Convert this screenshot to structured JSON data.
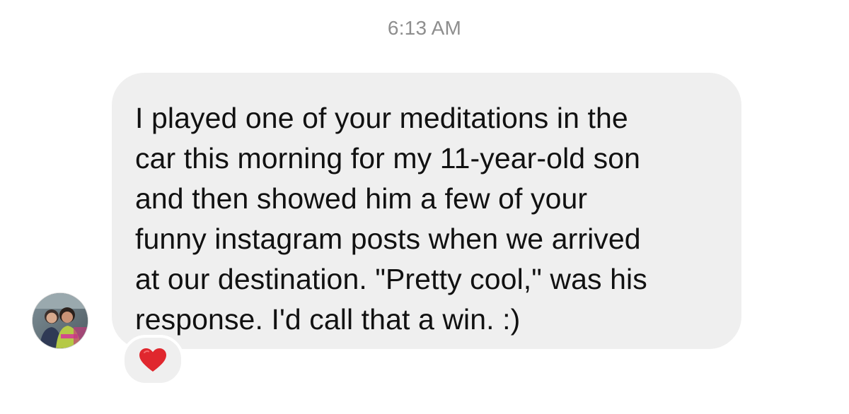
{
  "thread": {
    "timestamp": "6:13 AM"
  },
  "message": {
    "text": "I played one of your meditations in the\ncar this morning for my 11-year-old son\nand then showed him a few of your\nfunny instagram posts when we arrived\nat our destination. \"Pretty cool,\" was his\nresponse. I'd call that a win. :)",
    "bubble_color": "#efefef",
    "text_color": "#111111"
  },
  "reaction": {
    "icon": "red-heart-icon",
    "color": "#e0272e"
  },
  "sender": {
    "avatar_icon": "profile-photo"
  }
}
